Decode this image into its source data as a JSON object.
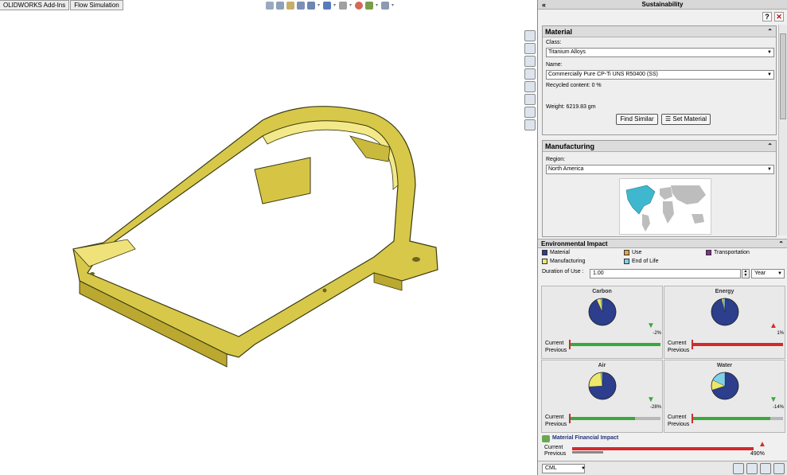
{
  "tabs": [
    "OLIDWORKS Add-Ins",
    "Flow Simulation"
  ],
  "view_icons": [
    "zoom-fit-icon",
    "zoom-area-icon",
    "previous-view-icon",
    "section-view-icon",
    "view-orientation-icon",
    "display-style-icon",
    "hide-show-icon",
    "edit-appearance-icon",
    "scene-icon",
    "view-settings-icon"
  ],
  "side_icons": [
    "home-icon",
    "parts-icon",
    "folder-icon",
    "properties-icon",
    "appearance-icon",
    "custom-icon",
    "sustainability-icon",
    "edit-icon"
  ],
  "pane": {
    "title": "Sustainability",
    "material": {
      "header": "Material",
      "class_label": "Class:",
      "class_value": "Titanium Alloys",
      "name_label": "Name:",
      "name_value": "Commercially Pure CP-Ti UNS R50400 (SS)",
      "recycled": "Recycled content: 0 %",
      "weight": "Weight:  6219.83 gm",
      "find_similar": "Find Similar",
      "set_material": "Set Material"
    },
    "manufacturing": {
      "header": "Manufacturing",
      "region_label": "Region:",
      "region_value": "North America"
    },
    "env": {
      "header": "Environmental Impact",
      "legend": [
        {
          "label": "Material",
          "color": "#2c3e8c"
        },
        {
          "label": "Use",
          "color": "#e8a33c"
        },
        {
          "label": "Transportation",
          "color": "#8a2a9a"
        },
        {
          "label": "Manufacturing",
          "color": "#ede86a"
        },
        {
          "label": "End of Life",
          "color": "#7fd1e8"
        }
      ],
      "duration_label": "Duration of Use :",
      "duration_value": "1.00",
      "duration_unit": "Year",
      "current_label": "Current",
      "previous_label": "Previous",
      "cards": [
        {
          "title": "Carbon",
          "change": "-2%",
          "direction": "down",
          "current": 1.0,
          "bar_color": "#3aa83a",
          "pie": [
            0.93,
            0.05,
            0.0,
            0.02
          ]
        },
        {
          "title": "Energy",
          "change": "1%",
          "direction": "up",
          "current": 1.0,
          "bar_color": "#d52a2a",
          "pie": [
            0.96,
            0.02,
            0.0,
            0.02
          ]
        },
        {
          "title": "Air",
          "change": "-28%",
          "direction": "down",
          "current": 0.72,
          "bar_color": "#3aa83a",
          "pie": [
            0.74,
            0.24,
            0.0,
            0.02
          ]
        },
        {
          "title": "Water",
          "change": "-14%",
          "direction": "down",
          "current": 0.86,
          "bar_color": "#3aa83a",
          "pie": [
            0.7,
            0.12,
            0.0,
            0.18
          ]
        }
      ],
      "financial": {
        "title": "Material Financial Impact",
        "change": "490%",
        "current": 1.0,
        "previous": 0.17
      }
    },
    "footer": {
      "report_format": "CML",
      "icons": [
        "report-icon",
        "send-icon",
        "save-icon",
        "help-web-icon"
      ]
    }
  }
}
